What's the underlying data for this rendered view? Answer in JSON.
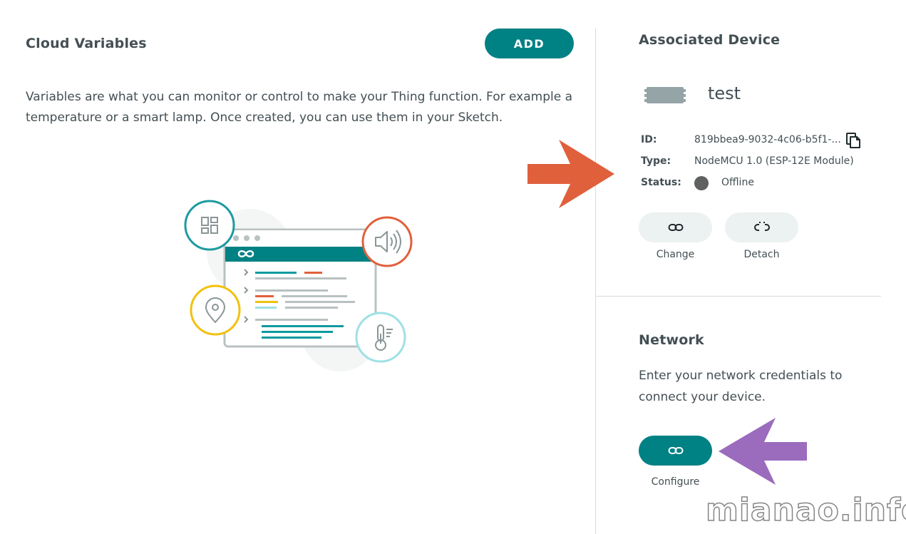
{
  "cloud_variables": {
    "title": "Cloud Variables",
    "add_label": "ADD",
    "description": "Variables are what you can monitor or control to make your Thing function. For example a temperature or a smart lamp. Once created, you can use them in your Sketch."
  },
  "associated_device": {
    "title": "Associated Device",
    "device_name": "test",
    "id_label": "ID:",
    "id_value": "819bbea9-9032-4c06-b5f1-...",
    "type_label": "Type:",
    "type_value": "NodeMCU 1.0 (ESP-12E Module)",
    "status_label": "Status:",
    "status_value": "Offline",
    "change_label": "Change",
    "detach_label": "Detach"
  },
  "network": {
    "title": "Network",
    "description": "Enter your network credentials to connect your device.",
    "configure_label": "Configure"
  },
  "watermark": "mianao.info",
  "colors": {
    "teal": "#008184",
    "text": "#434f54",
    "pill_bg": "#ecf1f1",
    "status_offline": "#5f6061",
    "arrow_orange": "#e0603c",
    "arrow_purple": "#9b6bbd"
  },
  "icons": [
    "link-icon",
    "unlink-icon",
    "copy-icon",
    "device-board-icon",
    "dashboard-icon",
    "speaker-icon",
    "location-pin-icon",
    "thermometer-icon",
    "infinity-logo-icon"
  ]
}
